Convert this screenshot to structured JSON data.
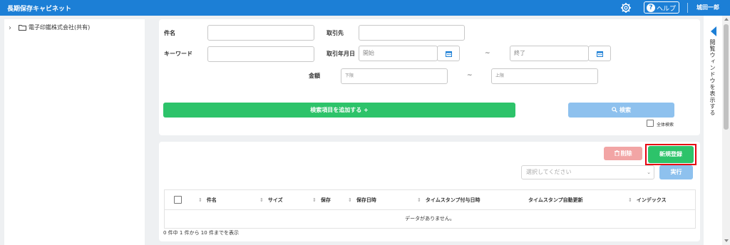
{
  "header": {
    "app_title": "長期保存キャビネット",
    "help_label": "ヘルプ",
    "user_name": "城田一郎",
    "settings_icon": "gear-icon",
    "help_icon": "question-circle-icon"
  },
  "sidebar": {
    "tree_root": "電子印鑑株式会社(共有)",
    "expand_icon": "chevron-right-icon",
    "folder_icon": "folder-icon"
  },
  "search": {
    "subject_label": "件名",
    "subject_value": "",
    "partner_label": "取引先",
    "partner_value": "",
    "keyword_label": "キーワード",
    "keyword_value": "",
    "date_label": "取引年月日",
    "date_start_placeholder": "開始",
    "date_end_placeholder": "終了",
    "range_sep": "~",
    "amount_label": "金額",
    "amount_min_placeholder": "下限",
    "amount_max_placeholder": "上限",
    "add_field_button": "検索項目を追加する +",
    "search_button": "検索",
    "search_icon": "magnifier-icon",
    "full_text_label": "全体検索",
    "full_text_checked": false
  },
  "list": {
    "delete_button": "削除",
    "delete_icon": "trash-icon",
    "new_button": "新規登録",
    "action_select_placeholder": "選択してください",
    "execute_button": "実行",
    "columns": [
      {
        "label": "件名",
        "sortable": true
      },
      {
        "label": "サイズ",
        "sortable": true
      },
      {
        "label": "保存",
        "sortable": true
      },
      {
        "label": "保存日時",
        "sortable": true
      },
      {
        "label": "タイムスタンプ付与日時",
        "sortable": true
      },
      {
        "label": "タイムスタンプ自動更新",
        "sortable": false
      },
      {
        "label": "インデックス",
        "sortable": true
      }
    ],
    "empty_message": "データがありません。",
    "record_count": "0 件中 1 件から 10 件までを表示"
  },
  "right_panel": {
    "toggle_label": "閲覧ウィンドウを表示する"
  },
  "colors": {
    "primary": "#1c7fd6",
    "success": "#2dc36a",
    "danger_light": "#f2a5a5",
    "disabled_blue": "#8ec1ee",
    "highlight_border": "#e60012"
  }
}
